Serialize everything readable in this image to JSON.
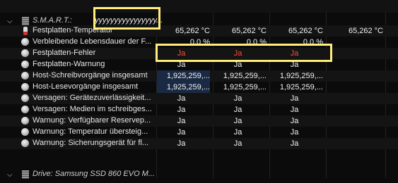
{
  "smart_section": {
    "label": "S.M.A.R.T.:",
    "value": "yyyyyyyyyyyyyyyy..."
  },
  "rows": [
    {
      "icon": "thermometer-icon",
      "label": "Festplatten-Temperatur",
      "values": [
        "65,262 °C",
        "65,262 °C",
        "65,262 °C",
        "65,262 °C"
      ]
    },
    {
      "icon": "status-circle-icon",
      "label": "Verbleibende Lebensdauer der F...",
      "values": [
        "0,0 %",
        "0,0 %",
        "0,0 %",
        ""
      ]
    },
    {
      "icon": "status-circle-icon",
      "label": "Festplatten-Fehler",
      "values": [
        "Ja",
        "Ja",
        "Ja",
        ""
      ]
    },
    {
      "icon": "status-circle-icon",
      "label": "Festplatten-Warnung",
      "values": [
        "Ja",
        "Ja",
        "Ja",
        ""
      ]
    },
    {
      "icon": "status-circle-icon",
      "label": "Host-Schreibvorgänge insgesamt",
      "values": [
        "1,925,259,...",
        "1,925,259,...",
        "1,925,259,...",
        ""
      ]
    },
    {
      "icon": "status-circle-icon",
      "label": "Host-Lesevorgänge insgesamt",
      "values": [
        "1,925,259,...",
        "1,925,259,...",
        "1,925,259,...",
        ""
      ]
    },
    {
      "icon": "status-circle-icon",
      "label": "Versagen:  Gerätezuverlässigkeit...",
      "values": [
        "Ja",
        "Ja",
        "Ja",
        ""
      ]
    },
    {
      "icon": "status-circle-icon",
      "label": "Versagen:  Medien im schreibges...",
      "values": [
        "Ja",
        "Ja",
        "Ja",
        ""
      ]
    },
    {
      "icon": "status-circle-icon",
      "label": "Warnung: Verfügbarer Reservep...",
      "values": [
        "Ja",
        "Ja",
        "Ja",
        ""
      ]
    },
    {
      "icon": "status-circle-icon",
      "label": "Warnung: Temperatur übersteig...",
      "values": [
        "Ja",
        "Ja",
        "Ja",
        ""
      ]
    },
    {
      "icon": "status-circle-icon",
      "label": "Warnung: Sicherungsgerät für fl...",
      "values": [
        "Ja",
        "Ja",
        "Ja",
        ""
      ]
    }
  ],
  "drive_section": {
    "label": "Drive: Samsung SSD 860 EVO M..."
  },
  "colors": {
    "error_text": "#ff4b3a",
    "highlight_cell": "#1b2a44",
    "annotation_box": "#ffee7a"
  }
}
